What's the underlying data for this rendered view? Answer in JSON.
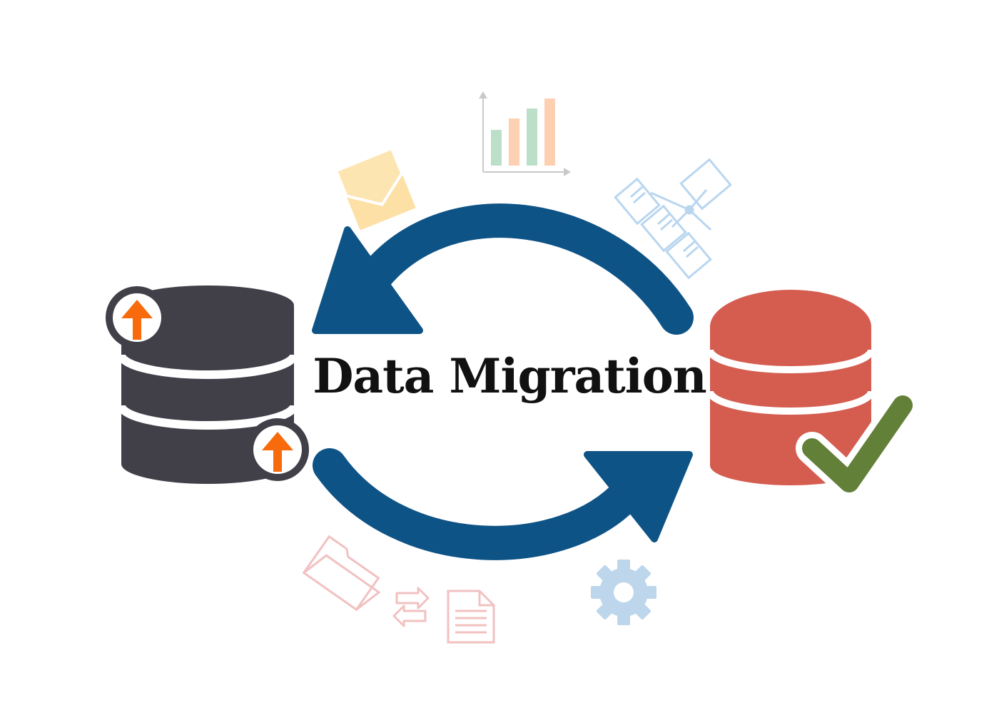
{
  "diagram": {
    "title": "Data Migration"
  },
  "colors": {
    "arrow": "#0e5386",
    "source_db": "#414049",
    "target_db": "#d45d50",
    "upload_arrow": "#f86b0c",
    "check": "#628038",
    "envelope": "#fde0a5",
    "chart_bar_green": "#bcdfc9",
    "chart_bar_orange": "#fcd0b1",
    "network": "#b9d6ef",
    "gear": "#bdd6ec",
    "files": "#f2c1c1"
  },
  "icons": [
    "database-source-icon",
    "database-target-icon",
    "upload-arrow-icon",
    "checkmark-icon",
    "envelope-icon",
    "bar-chart-icon",
    "network-icon",
    "folder-icon",
    "exchange-arrows-icon",
    "document-icon",
    "gear-icon"
  ]
}
